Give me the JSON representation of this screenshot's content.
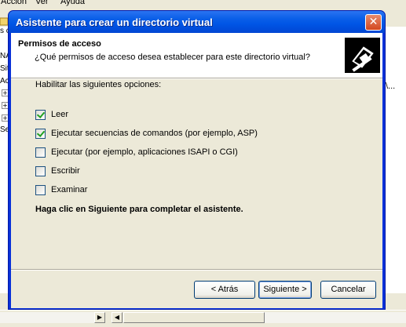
{
  "background_window": {
    "menu": [
      "Acción",
      "Ver",
      "Ayuda"
    ],
    "tree_fragments": [
      "s c",
      "NA",
      "Sit",
      "Ac",
      "Se"
    ],
    "right_fragment": "\\..."
  },
  "wizard": {
    "title": "Asistente para crear un directorio virtual",
    "close_glyph": "✕",
    "header": {
      "title": "Permisos de acceso",
      "subtitle": "¿Qué permisos de acceso desea establecer para este directorio virtual?"
    },
    "instruction": "Habilitar las siguientes opciones:",
    "options": [
      {
        "label": "Leer",
        "checked": true
      },
      {
        "label": "Ejecutar secuencias de comandos (por ejemplo, ASP)",
        "checked": true
      },
      {
        "label": "Ejecutar (por ejemplo, aplicaciones ISAPI o CGI)",
        "checked": false
      },
      {
        "label": "Escribir",
        "checked": false
      },
      {
        "label": "Examinar",
        "checked": false
      }
    ],
    "finish_text": "Haga clic en Siguiente para completar el asistente.",
    "buttons": {
      "back": "< Atrás",
      "next": "Siguiente >",
      "cancel": "Cancelar"
    }
  },
  "colors": {
    "title_bar": "#0055e5",
    "dialog_face": "#ece9d8",
    "checkmark": "#21a121"
  }
}
